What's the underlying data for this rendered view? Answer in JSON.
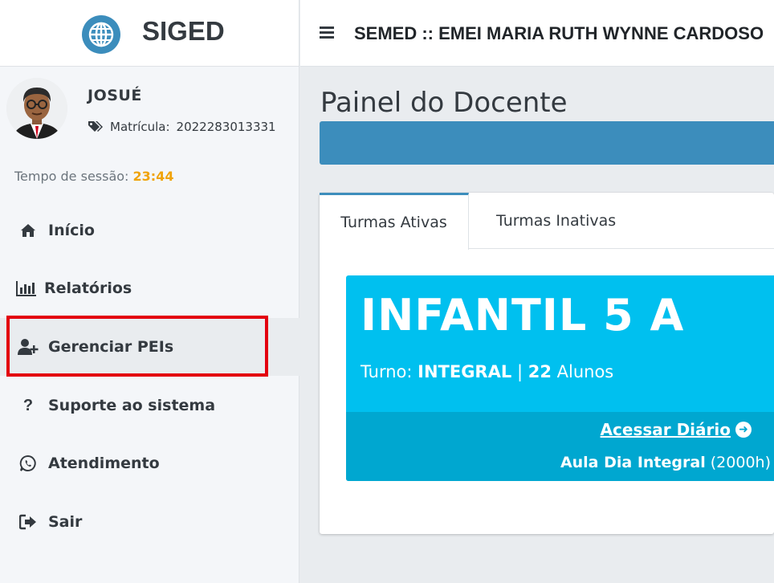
{
  "brand": {
    "name": "SIGED"
  },
  "topbar": {
    "title": "SEMED :: EMEI MARIA RUTH WYNNE CARDOSO"
  },
  "user": {
    "name": "JOSUÉ",
    "matricula_label": "Matrícula:",
    "matricula_value": "2022283013331"
  },
  "session": {
    "label": "Tempo de sessão:",
    "time": "23:44"
  },
  "nav": [
    {
      "label": "Início",
      "icon": "home-icon"
    },
    {
      "label": "Relatórios",
      "icon": "bar-chart-icon"
    },
    {
      "label": "Gerenciar PEIs",
      "icon": "user-plus-icon"
    },
    {
      "label": "Suporte ao sistema",
      "icon": "question-icon"
    },
    {
      "label": "Atendimento",
      "icon": "whatsapp-icon"
    },
    {
      "label": "Sair",
      "icon": "sign-out-icon"
    }
  ],
  "page": {
    "title": "Painel do Docente"
  },
  "tabs": [
    {
      "label": "Turmas Ativas",
      "active": true
    },
    {
      "label": "Turmas Inativas",
      "active": false
    }
  ],
  "class_card": {
    "name": "INFANTIL 5 A",
    "turno_label": "Turno:",
    "turno_value": "INTEGRAL",
    "separator": "|",
    "alunos_count": "22",
    "alunos_label": "Alunos",
    "access_label": "Acessar Diário",
    "aula_label": "Aula Dia Integral",
    "aula_hours": "(2000h)"
  },
  "colors": {
    "primary": "#3c8dbc",
    "info": "#00c0ef",
    "info_dark": "#00a7d0",
    "session_time": "#f0a30a",
    "highlight": "#e3000f"
  }
}
